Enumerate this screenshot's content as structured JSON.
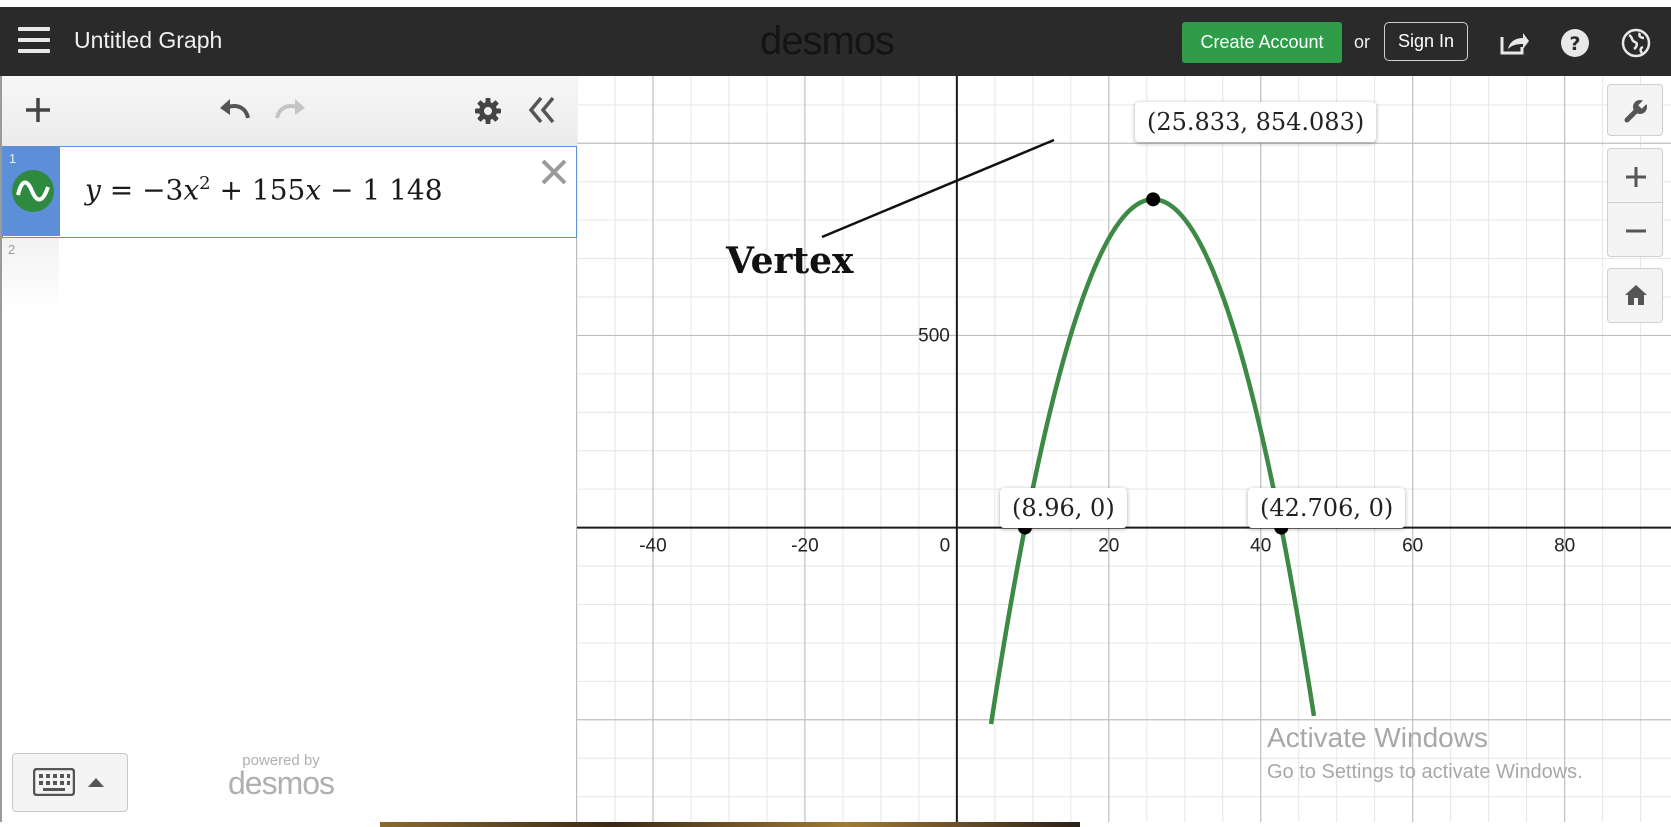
{
  "app": {
    "graph_title": "Untitled Graph",
    "logo": "desmos",
    "create_account": "Create Account",
    "or": "or",
    "sign_in": "Sign In"
  },
  "icons": {
    "menu": "hamburger-icon",
    "share": "share-icon",
    "help": "help-icon",
    "language": "globe-icon",
    "add": "plus-icon",
    "undo": "undo-icon",
    "redo": "redo-icon",
    "settings": "gear-icon",
    "collapse": "double-chevron-left-icon",
    "wrench": "wrench-icon",
    "zoom_in": "zoom-in-icon",
    "zoom_out": "zoom-out-icon",
    "home": "home-icon",
    "keyboard": "keyboard-icon"
  },
  "expressions": [
    {
      "index": "1",
      "lhs": "y",
      "eq": " = −3",
      "var": "x",
      "exp": "2",
      "rest1": " + 155",
      "var2": "x",
      "rest2": " − 1 148",
      "color": "#2d8a3e"
    },
    {
      "index": "2"
    }
  ],
  "powered_by": {
    "small": "powered by",
    "logo": "desmos"
  },
  "graph": {
    "x_ticks": [
      "-40",
      "-20",
      "0",
      "20",
      "40",
      "60",
      "80"
    ],
    "y_tick": "500",
    "curve_color": "#3c8a45",
    "points": {
      "vertex": "(25.833, 854.083)",
      "root1": "(8.96, 0)",
      "root2": "(42.706, 0)"
    },
    "annotation": "Vertex"
  },
  "chart_data": {
    "type": "line",
    "title": "",
    "xlabel": "",
    "ylabel": "",
    "equation": "y = -3x^2 + 155x - 1148",
    "xlim": [
      -50,
      94
    ],
    "ylim": [
      -766,
      1175
    ],
    "x_ticks": [
      -40,
      -20,
      0,
      20,
      40,
      60,
      80
    ],
    "y_ticks": [
      500
    ],
    "grid": true,
    "series": [
      {
        "color": "#3c8a45",
        "x": [
          4.5,
          8.96,
          12,
          16,
          20,
          24,
          25.833,
          28,
          32,
          36,
          40,
          42.706,
          47
        ],
        "y": [
          -513.25,
          0,
          280,
          564,
          752,
          844,
          854.083,
          840,
          740,
          544,
          252,
          0,
          -490
        ]
      }
    ],
    "marked_points": [
      {
        "x": 25.833,
        "y": 854.083
      },
      {
        "x": 8.96,
        "y": 0
      },
      {
        "x": 42.706,
        "y": 0
      }
    ]
  },
  "watermark": {
    "line1": "Activate Windows",
    "line2": "Go to Settings to activate Windows."
  }
}
